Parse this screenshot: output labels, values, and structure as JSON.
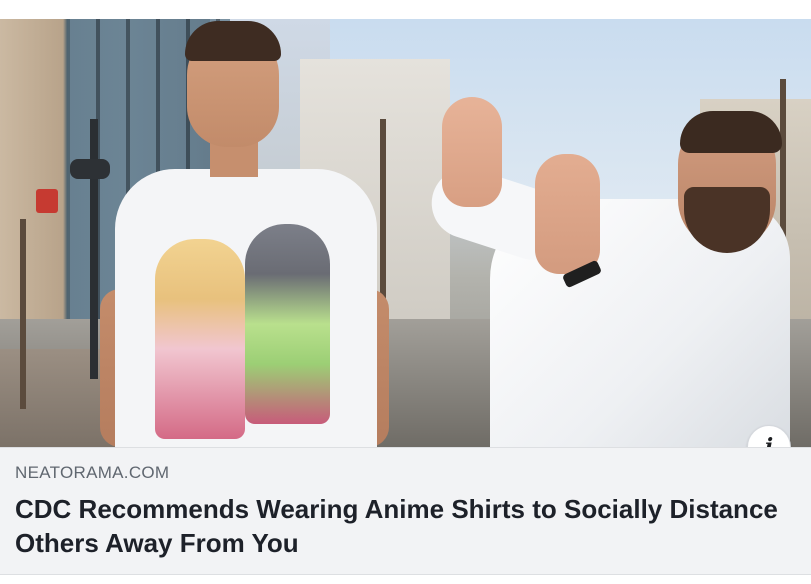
{
  "link_preview": {
    "domain": "NEATORAMA.COM",
    "headline": "CDC Recommends Wearing Anime Shirts to Socially Distance Others Away From You",
    "info_icon": "i"
  },
  "image": {
    "subject_icons": [
      "info-icon"
    ]
  }
}
